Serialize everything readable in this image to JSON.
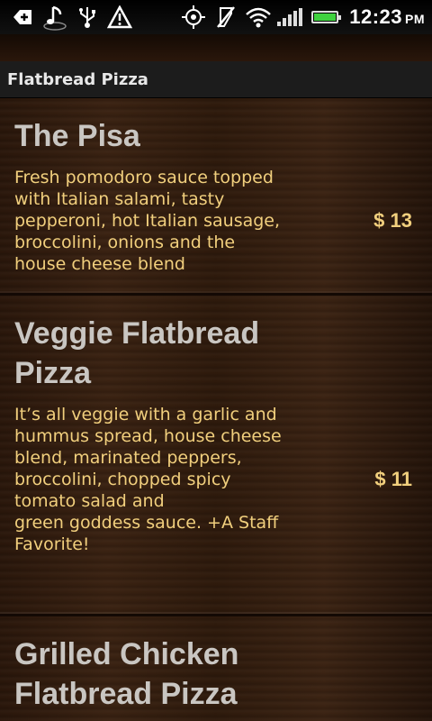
{
  "status_bar": {
    "icons_left": [
      "plus-notification-icon",
      "music-note-icon",
      "usb-icon",
      "warning-icon"
    ],
    "icons_right": [
      "gps-icon",
      "vibrate-off-icon",
      "wifi-icon",
      "signal-icon",
      "battery-icon"
    ],
    "time": "12:23",
    "ampm": "PM",
    "battery_color": "#3fd13f"
  },
  "header": {
    "title": "Flatbread Pizza"
  },
  "menu": {
    "items": [
      {
        "name": "The Pisa",
        "description": "Fresh pomodoro sauce topped\nwith Italian salami, tasty\npepperoni, hot Italian sausage,\nbroccolini, onions and the\nhouse cheese blend",
        "price": "$ 13"
      },
      {
        "name": "Veggie Flatbread Pizza",
        "description": "It’s all veggie with a garlic and\nhummus spread, house cheese\nblend, marinated peppers,\nbroccolini, chopped spicy\ntomato salad and\ngreen goddess sauce. +A Staff\nFavorite!",
        "price": "$ 11"
      },
      {
        "name": "Grilled Chicken Flatbread Pizza",
        "description": "",
        "price": ""
      }
    ]
  },
  "colors": {
    "name_text": "#c9c6c2",
    "desc_text": "#f1cf7d",
    "wood_dark": "#2a170b"
  }
}
